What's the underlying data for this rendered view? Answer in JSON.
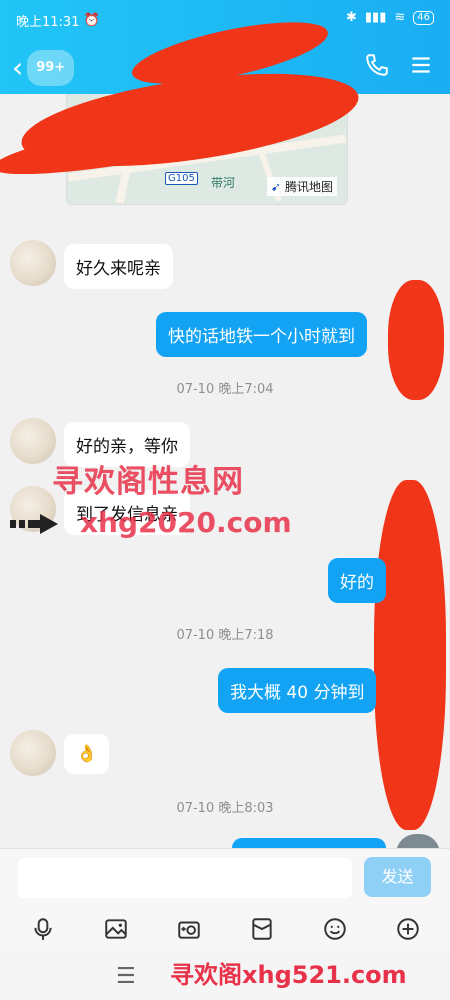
{
  "status": {
    "time": "晚上11:31",
    "battery": "46"
  },
  "header": {
    "unread_badge": "99+"
  },
  "map": {
    "road_label": "G105",
    "river_label": "带河",
    "logo": "腾讯地图"
  },
  "messages": [
    {
      "dir": "in",
      "text": "好久来呢亲"
    },
    {
      "dir": "out",
      "text": "快的话地铁一个小时就到"
    },
    {
      "time": "07-10 晚上7:04"
    },
    {
      "dir": "in",
      "text": "好的亲，等你"
    },
    {
      "dir": "in",
      "text": "到了发信息亲"
    },
    {
      "dir": "out",
      "text": "好的"
    },
    {
      "time": "07-10 晚上7:18"
    },
    {
      "dir": "out",
      "text": "我大概 40 分钟到"
    },
    {
      "dir": "in",
      "text": "👌"
    },
    {
      "time": "07-10 晚上8:03"
    }
  ],
  "watermark": {
    "line1": "寻欢阁性息网",
    "line2": "xhg2020.com",
    "bottom": "寻欢阁xhg521.com"
  },
  "composer": {
    "send_label": "发送"
  },
  "toolbar_icons": [
    "microphone-icon",
    "image-icon",
    "camera-icon",
    "red-packet-icon",
    "emoji-icon",
    "plus-icon"
  ],
  "colors": {
    "header": "#1aaef3",
    "outgoing_bubble": "#12a3f5",
    "redaction": "#f03518",
    "watermark": "#e8324a"
  }
}
